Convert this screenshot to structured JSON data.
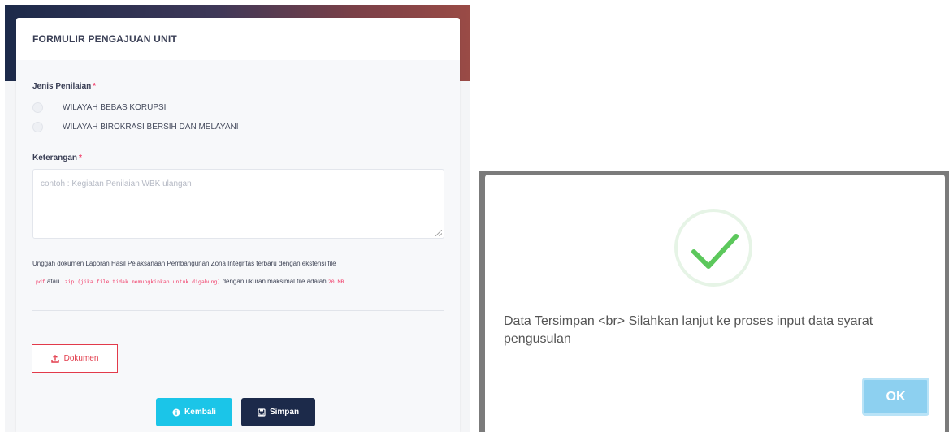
{
  "form": {
    "title": "FORMULIR PENGAJUAN UNIT",
    "jenis_label": "Jenis Penilaian",
    "required_mark": "*",
    "options": [
      "WILAYAH BEBAS KORUPSI",
      "WILAYAH BIROKRASI BERSIH DAN MELAYANI"
    ],
    "keterangan_label": "Keterangan",
    "keterangan_placeholder": "contoh : Kegiatan Penilaian WBK ulangan",
    "info_line1": "Unggah dokumen Laporan Hasil Pelaksanaan Pembangunan Zona Integritas terbaru dengan ekstensi file",
    "info_ext_pdf": ".pdf",
    "info_atau": " atau ",
    "info_ext_zip": ".zip (jika file tidak memungkinkan untuk digabung)",
    "info_size_text": " dengan ukuran maksimal file adalah ",
    "info_size": "20 MB.",
    "dokumen_label": "Dokumen",
    "kembali_label": "Kembali",
    "simpan_label": "Simpan"
  },
  "dialog": {
    "message": "Data Tersimpan <br> Silahkan lanjut ke proses input data syarat pengusulan",
    "ok_label": "OK"
  },
  "icons": {
    "upload": "upload-icon",
    "info": "info-icon",
    "save": "save-icon",
    "success": "checkmark-icon"
  },
  "colors": {
    "primary_dark": "#1c2a4a",
    "info_cyan": "#1bc5e8",
    "danger": "#e23a4a",
    "success": "#5cc85c",
    "ok_button": "#8dd0f0"
  }
}
